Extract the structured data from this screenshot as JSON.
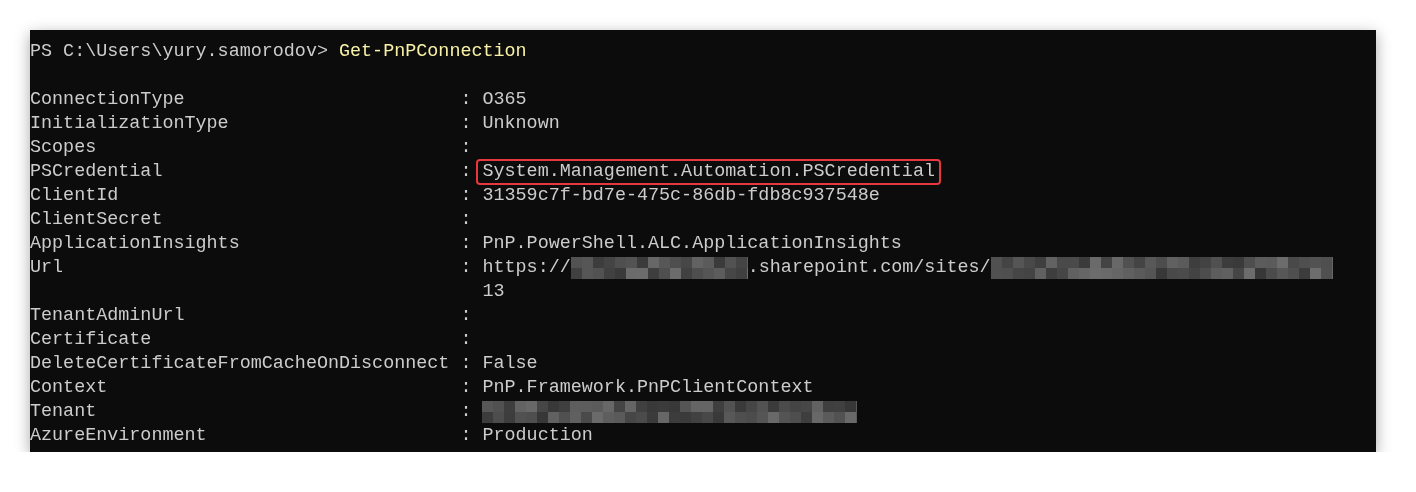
{
  "prompt": {
    "path": "PS C:\\Users\\yury.samorodov> ",
    "command": "Get-PnPConnection"
  },
  "separator": ":",
  "rows": [
    {
      "key": "ConnectionType",
      "highlighted": false,
      "lines": [
        [
          {
            "kind": "text",
            "text": "O365"
          }
        ]
      ]
    },
    {
      "key": "InitializationType",
      "highlighted": false,
      "lines": [
        [
          {
            "kind": "text",
            "text": "Unknown"
          }
        ]
      ]
    },
    {
      "key": "Scopes",
      "highlighted": false,
      "lines": []
    },
    {
      "key": "PSCredential",
      "highlighted": true,
      "lines": [
        [
          {
            "kind": "text",
            "text": "System.Management.Automation.PSCredential"
          }
        ]
      ]
    },
    {
      "key": "ClientId",
      "highlighted": false,
      "lines": [
        [
          {
            "kind": "text",
            "text": "31359c7f-bd7e-475c-86db-fdb8c937548e"
          }
        ]
      ]
    },
    {
      "key": "ClientSecret",
      "highlighted": false,
      "lines": []
    },
    {
      "key": "ApplicationInsights",
      "highlighted": false,
      "lines": [
        [
          {
            "kind": "text",
            "text": "PnP.PowerShell.ALC.ApplicationInsights"
          }
        ]
      ]
    },
    {
      "key": "Url",
      "highlighted": false,
      "lines": [
        [
          {
            "kind": "text",
            "text": "https://"
          },
          {
            "kind": "redacted"
          },
          {
            "kind": "text",
            "text": ".sharepoint.com/sites/"
          },
          {
            "kind": "redacted"
          }
        ],
        [
          {
            "kind": "text",
            "text": "13"
          }
        ]
      ]
    },
    {
      "key": "TenantAdminUrl",
      "highlighted": false,
      "lines": []
    },
    {
      "key": "Certificate",
      "highlighted": false,
      "lines": []
    },
    {
      "key": "DeleteCertificateFromCacheOnDisconnect",
      "highlighted": false,
      "lines": [
        [
          {
            "kind": "text",
            "text": "False"
          }
        ]
      ]
    },
    {
      "key": "Context",
      "highlighted": false,
      "lines": [
        [
          {
            "kind": "text",
            "text": "PnP.Framework.PnPClientContext"
          }
        ]
      ]
    },
    {
      "key": "Tenant",
      "highlighted": false,
      "lines": [
        [
          {
            "kind": "redacted"
          }
        ]
      ]
    },
    {
      "key": "AzureEnvironment",
      "highlighted": false,
      "lines": [
        [
          {
            "kind": "text",
            "text": "Production"
          }
        ]
      ]
    }
  ]
}
